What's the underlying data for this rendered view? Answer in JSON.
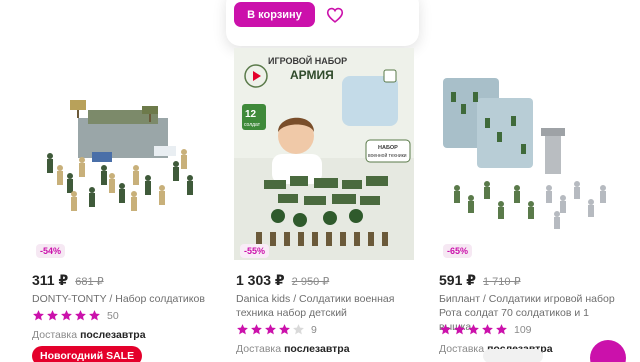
{
  "hover": {
    "cart_button_label": "В корзину",
    "favorite_icon": "heart-icon"
  },
  "products": [
    {
      "discount": "-54%",
      "price": "311 ₽",
      "old_price": "681 ₽",
      "brand": "DONTY-TONTY",
      "name": "Набор солдатиков",
      "rating": 5,
      "reviews": "50",
      "delivery_label": "Доставка",
      "delivery_value": "послезавтра",
      "promo": "Новогодний SALE"
    },
    {
      "discount": "-55%",
      "price": "1 303 ₽",
      "old_price": "2 950 ₽",
      "brand": "Danica kids",
      "name": "Солдатики военная техника набор детский",
      "rating": 4,
      "reviews": "9",
      "delivery_label": "Доставка",
      "delivery_value": "послезавтра",
      "image_text": {
        "line1": "ИГРОВОЙ НАБОР",
        "line2": "АРМИЯ",
        "count": "12",
        "count_label": "солдат",
        "caption_line1": "НАБОР",
        "caption_line2": "военной техники"
      }
    },
    {
      "discount": "-65%",
      "price": "591 ₽",
      "old_price": "1 710 ₽",
      "brand": "Биплант",
      "name": "Солдатики игровой набор Рота солдат 70 солдатиков и 1 вышка",
      "rating": 5,
      "reviews": "109",
      "delivery_label": "Доставка",
      "delivery_value": "послезавтра"
    }
  ],
  "colors": {
    "accent": "#cb11ab",
    "sale": "#e4002b",
    "star": "#cb11ab",
    "star_empty": "#d9d9d9"
  }
}
